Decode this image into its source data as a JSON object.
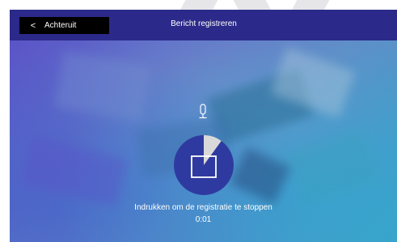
{
  "header": {
    "back_label": "Achteruit",
    "back_chevron": "<",
    "title": "Bericht registreren"
  },
  "recording": {
    "instruction": "Indrukken om de registratie te stoppen",
    "elapsed": "0:01",
    "progress_fraction": 0.1
  },
  "icons": {
    "microphone": "microphone-icon",
    "stop": "stop-icon"
  },
  "colors": {
    "header_bg": "#2b2a8a",
    "back_button_bg": "#000000",
    "record_circle": "#2f3aa0",
    "progress_wedge": "#d9d9d9"
  }
}
